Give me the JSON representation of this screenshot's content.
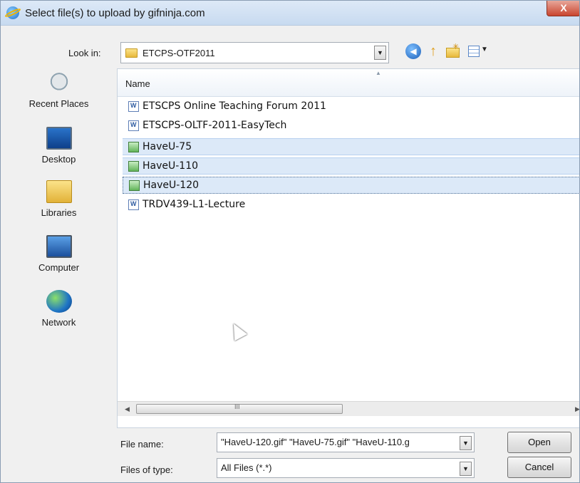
{
  "window": {
    "title": "Select file(s) to upload by gifninja.com",
    "close_label": "X"
  },
  "toolbar": {
    "look_in_label": "Look in:",
    "look_in_value": "ETCPS-OTF2011",
    "icons": [
      "back-icon",
      "up-folder-icon",
      "new-folder-icon",
      "views-menu-icon"
    ]
  },
  "places": [
    {
      "label": "Recent Places",
      "icon": "recent-places-icon"
    },
    {
      "label": "Desktop",
      "icon": "desktop-icon"
    },
    {
      "label": "Libraries",
      "icon": "libraries-icon"
    },
    {
      "label": "Computer",
      "icon": "computer-icon"
    },
    {
      "label": "Network",
      "icon": "network-icon"
    }
  ],
  "file_list": {
    "column_name": "Name",
    "files": [
      {
        "name": "ETSCPS Online Teaching Forum 2011",
        "type": "doc",
        "selected": false
      },
      {
        "name": "ETSCPS-OLTF-2011-EasyTech",
        "type": "doc",
        "selected": false
      },
      {
        "name": "HaveU-75",
        "type": "gif",
        "selected": true
      },
      {
        "name": "HaveU-110",
        "type": "gif",
        "selected": true
      },
      {
        "name": "HaveU-120",
        "type": "gif",
        "selected": true,
        "focused": true
      },
      {
        "name": "TRDV439-L1-Lecture",
        "type": "doc",
        "selected": false
      }
    ],
    "scroll_grip": "III"
  },
  "bottom": {
    "file_name_label": "File name:",
    "file_name_value": "\"HaveU-120.gif\" \"HaveU-75.gif\" \"HaveU-110.g",
    "files_of_type_label": "Files of type:",
    "files_of_type_value": "All Files (*.*)",
    "open_label": "Open",
    "cancel_label": "Cancel"
  },
  "colors": {
    "selection": "#dce9f8",
    "titlebar": "#c7daf0",
    "close": "#c9452f"
  }
}
